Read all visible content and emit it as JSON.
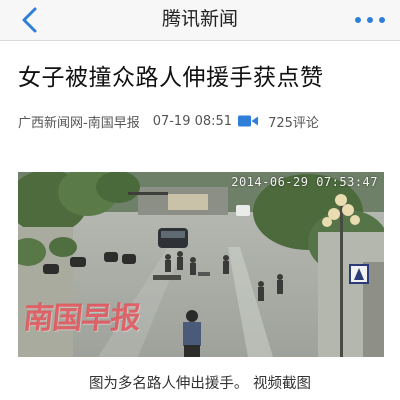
{
  "navbar": {
    "title": "腾讯新闻",
    "back_icon": "chevron-left-icon",
    "more_icon": "more-dots-icon",
    "accent_color": "#2f7fd8"
  },
  "article": {
    "headline": "女子被撞众路人伸援手获点赞",
    "source": "广西新闻网-南国早报",
    "time": "07-19 08:51",
    "video_icon": "video-camera-icon",
    "comments": "725评论"
  },
  "image": {
    "timestamp": "2014-06-29 07:53:47",
    "watermark": "南国早报",
    "caption": "图为多名路人伸出援手。 视频截图"
  }
}
